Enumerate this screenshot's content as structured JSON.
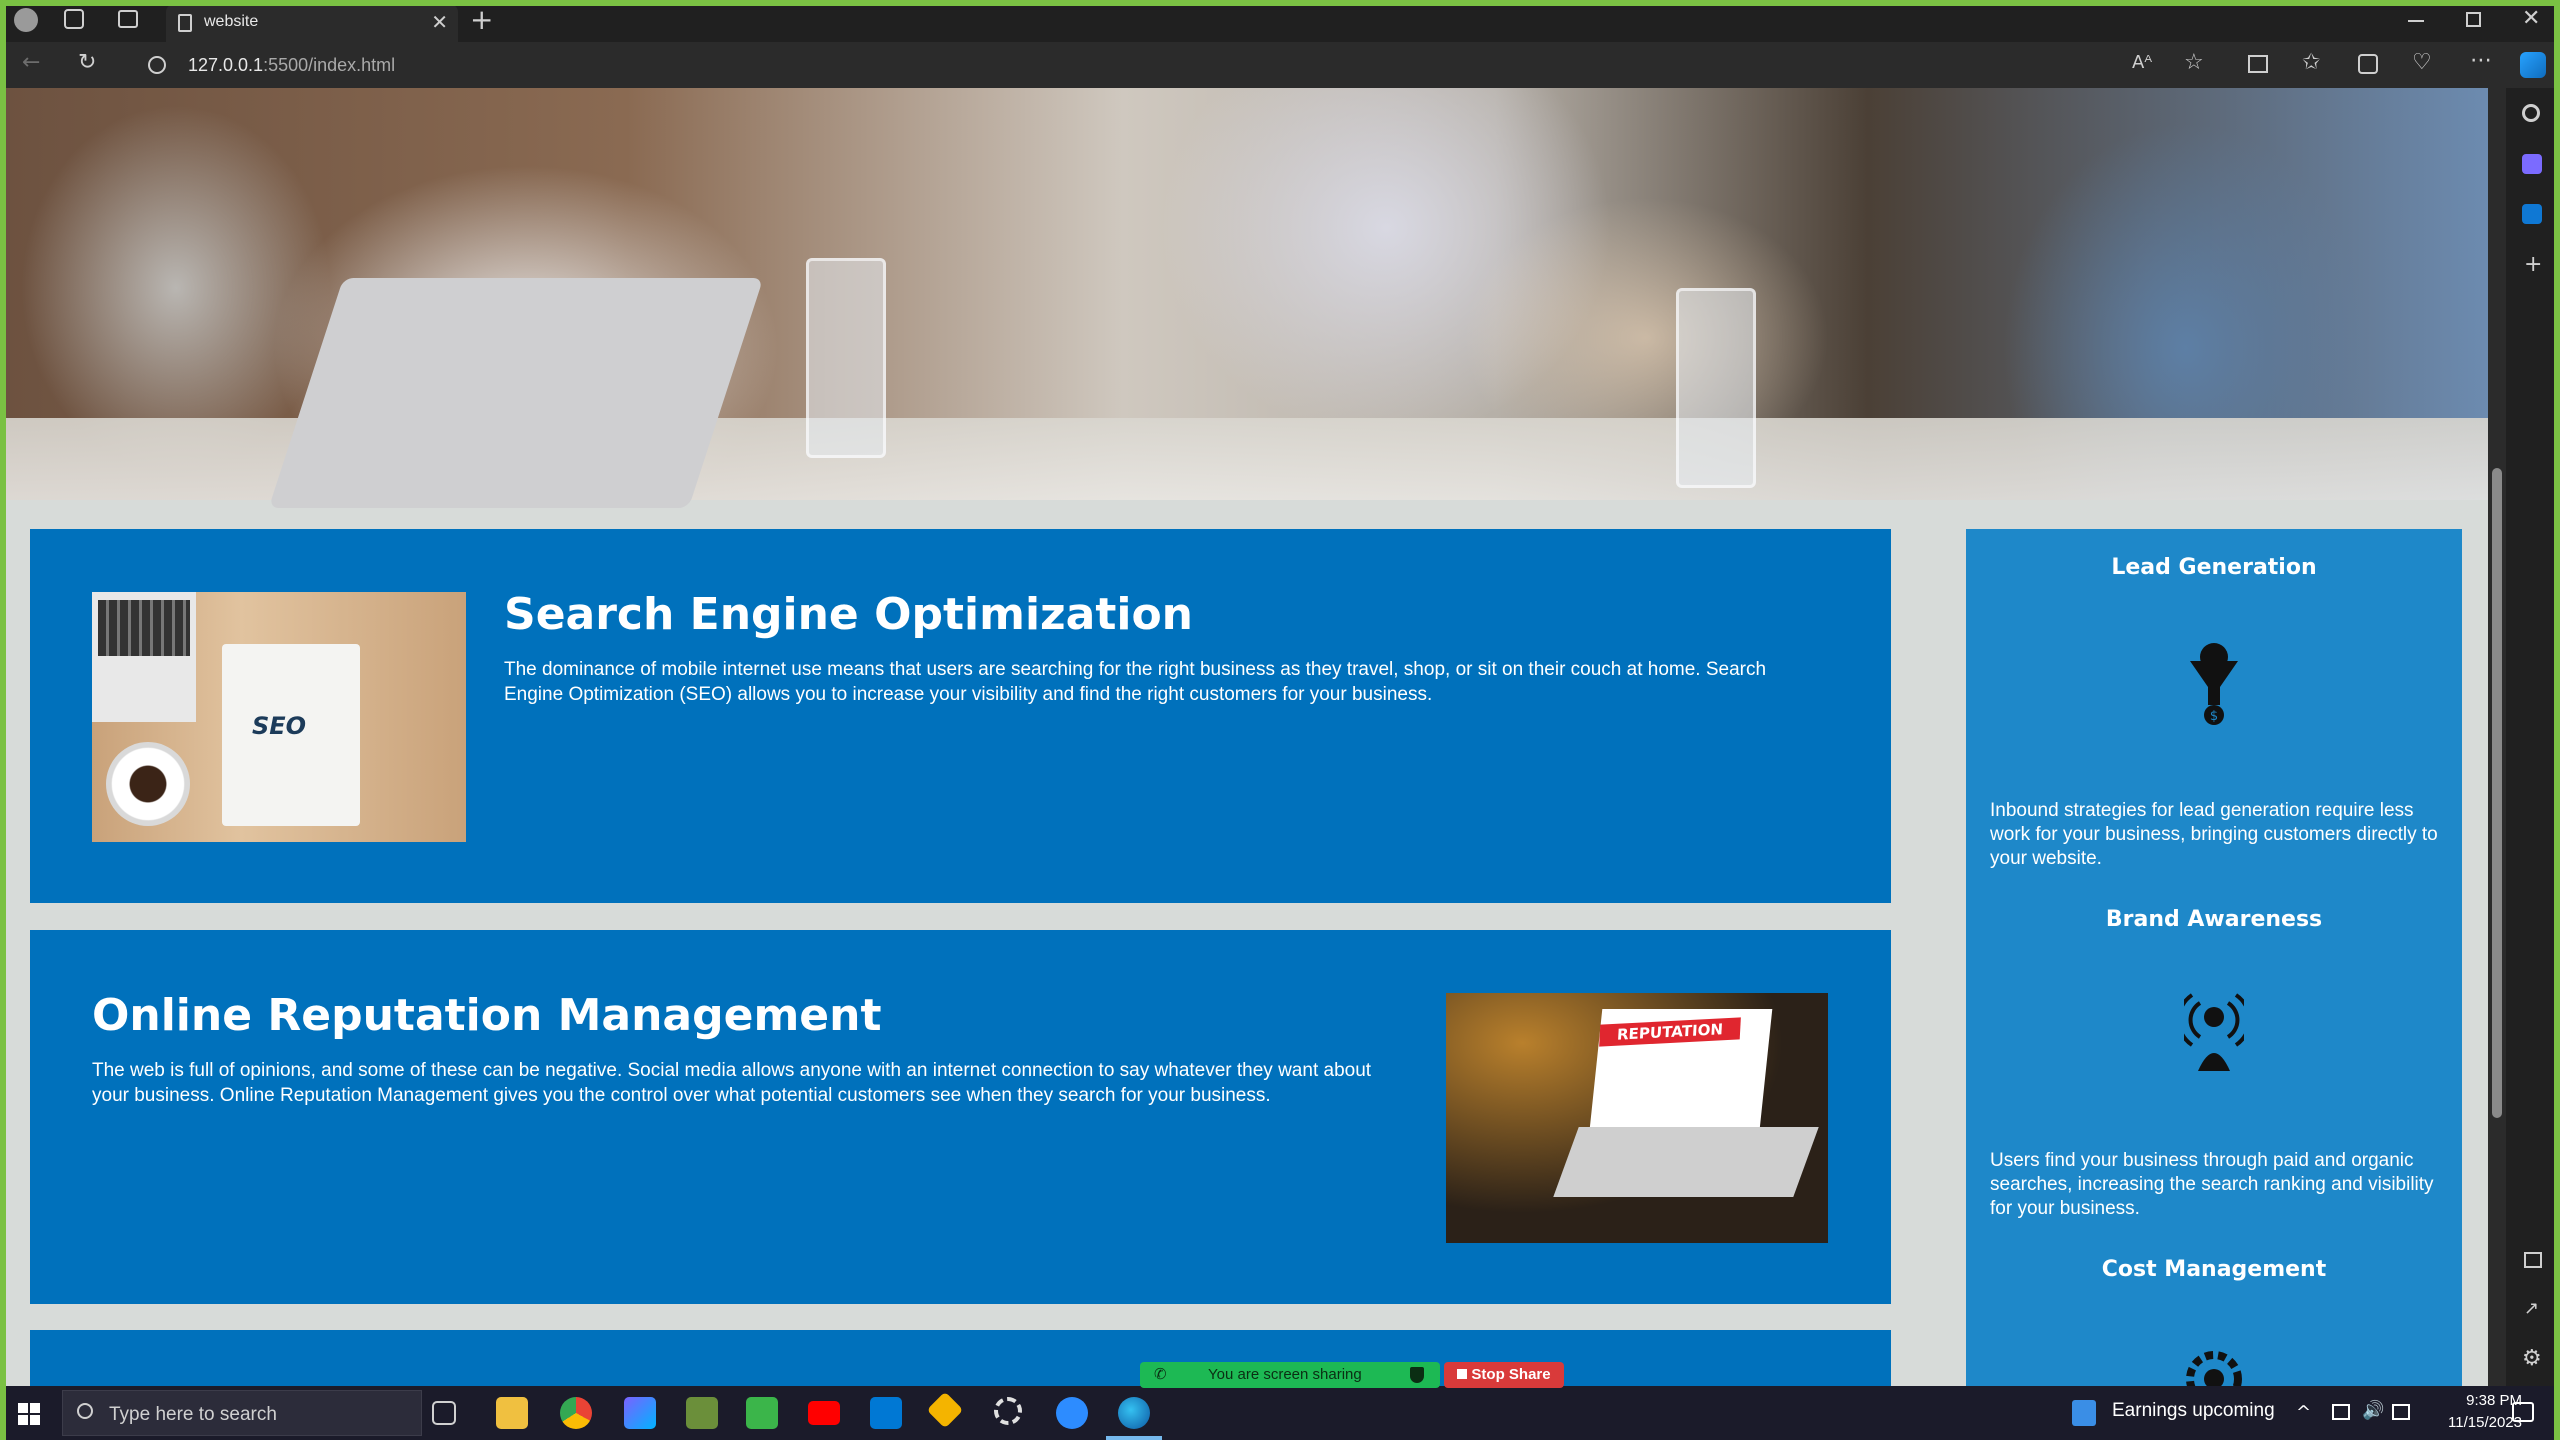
{
  "browser": {
    "tab_title": "website",
    "address_host": "127.0.0.1",
    "address_path": ":5500/index.html",
    "new_tab_symbol": "+",
    "close_symbol": "✕"
  },
  "page": {
    "seo": {
      "title": "Search Engine Optimization",
      "text": "The dominance of mobile internet use means that users are searching for the right business as they travel, shop, or sit on their couch at home. Search Engine Optimization (SEO) allows you to increase your visibility and find the right customers for your business.",
      "image_label": "SEO"
    },
    "orm": {
      "title": "Online Reputation Management",
      "text": "The web is full of opinions, and some of these can be negative. Social media allows anyone with an internet connection to say whatever they want about your business. Online Reputation Management gives you the control over what potential customers see when they search for your business.",
      "image_label": "REPUTATION"
    },
    "sidebar": {
      "items": [
        {
          "title": "Lead Generation",
          "text": "Inbound strategies for lead generation require less work for your business, bringing customers directly to your website.",
          "icon": "funnel-dollar-icon"
        },
        {
          "title": "Brand Awareness",
          "text": "Users find your business through paid and organic searches, increasing the search ranking and visibility for your business.",
          "icon": "broadcast-person-icon"
        },
        {
          "title": "Cost Management",
          "text": "",
          "icon": "gear-icon"
        }
      ]
    }
  },
  "screen_share": {
    "status": "You are screen sharing",
    "stop": "Stop Share"
  },
  "taskbar": {
    "search_placeholder": "Type here to search",
    "news": "Earnings upcoming",
    "time": "9:38 PM",
    "date": "11/15/2023"
  },
  "colors": {
    "card_blue": "#0071bc",
    "sidebar_blue": "#1e88c9",
    "page_bg": "#d7dbd9",
    "share_green": "#1db954",
    "stop_red": "#d93a3a",
    "frame_green": "#7ac143"
  }
}
